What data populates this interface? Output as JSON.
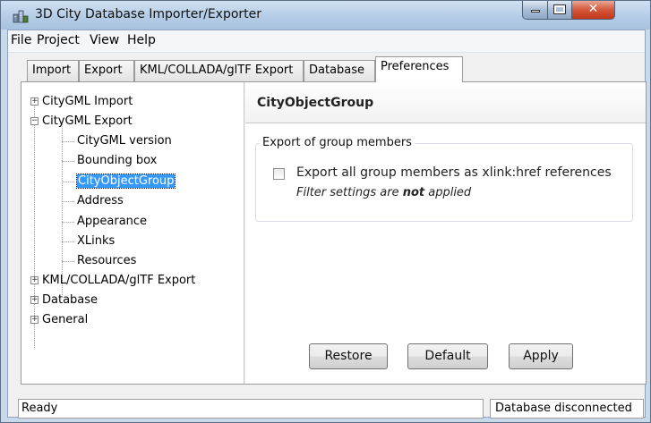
{
  "window": {
    "title": "3D City Database Importer/Exporter",
    "icon": "city-database-app-icon",
    "controls": {
      "minimize": "minimize-icon",
      "maximize": "maximize-icon",
      "close": "close-icon"
    }
  },
  "menubar": {
    "items": [
      {
        "label": "File"
      },
      {
        "label": "Project"
      },
      {
        "label": "View"
      },
      {
        "label": "Help"
      }
    ]
  },
  "tabs": [
    {
      "label": "Import",
      "active": false
    },
    {
      "label": "Export",
      "active": false
    },
    {
      "label": "KML/COLLADA/glTF Export",
      "active": false
    },
    {
      "label": "Database",
      "active": false
    },
    {
      "label": "Preferences",
      "active": true
    }
  ],
  "tree": {
    "nodes": [
      {
        "label": "CityGML Import",
        "expander": "+"
      },
      {
        "label": "CityGML Export",
        "expander": "−",
        "children": [
          {
            "label": "CityGML version"
          },
          {
            "label": "Bounding box"
          },
          {
            "label": "CityObjectGroup",
            "selected": true
          },
          {
            "label": "Address"
          },
          {
            "label": "Appearance"
          },
          {
            "label": "XLinks"
          },
          {
            "label": "Resources"
          }
        ]
      },
      {
        "label": "KML/COLLADA/glTF Export",
        "expander": "+"
      },
      {
        "label": "Database",
        "expander": "+"
      },
      {
        "label": "General",
        "expander": "+"
      }
    ]
  },
  "panel": {
    "title": "CityObjectGroup",
    "group": {
      "legend": "Export of group members",
      "checkbox": {
        "label": "Export all group members as xlink:href references",
        "checked": false
      },
      "hint_prefix": "Filter settings are ",
      "hint_emphasis": "not",
      "hint_suffix": " applied"
    },
    "buttons": {
      "restore": "Restore",
      "default": "Default",
      "apply": "Apply"
    }
  },
  "statusbar": {
    "left": "Ready",
    "right": "Database disconnected"
  }
}
